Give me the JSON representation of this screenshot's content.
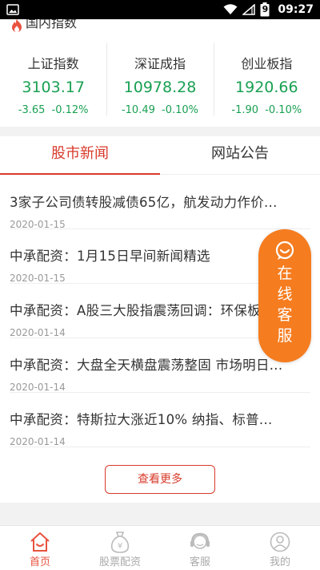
{
  "status_bar": {
    "time": "09:27",
    "battery_level": "9"
  },
  "indices_section": {
    "title": "国内指数",
    "items": [
      {
        "name": "上证指数",
        "value": "3103.17",
        "change": "-3.65",
        "percent": "-0.12%"
      },
      {
        "name": "深证成指",
        "value": "10978.28",
        "change": "-10.49",
        "percent": "-0.10%"
      },
      {
        "name": "创业板指",
        "value": "1920.66",
        "change": "-1.90",
        "percent": "-0.10%"
      }
    ],
    "down_color": "#19a052"
  },
  "news": {
    "tabs": [
      {
        "label": "股市新闻",
        "active": true
      },
      {
        "label": "网站公告",
        "active": false
      }
    ],
    "items": [
      {
        "title": "3家子公司债转股减债65亿，航发动力作价...",
        "date": "2020-01-15"
      },
      {
        "title": "中承配资：1月15日早间新闻精选",
        "date": "2020-01-15"
      },
      {
        "title": "中承配资：A股三大股指震荡回调：环保板块表现活跃",
        "date": "2020-01-14"
      },
      {
        "title": "中承配资：大盘全天横盘震荡整固 市场明日...",
        "date": "2020-01-14"
      },
      {
        "title": "中承配资：特斯拉大涨近10% 纳指、标普...",
        "date": "2020-01-14"
      }
    ],
    "more_label": "查看更多"
  },
  "float_service": {
    "chars": [
      "在",
      "线",
      "客",
      "服"
    ],
    "color": "#f57c1f"
  },
  "bottom_nav": [
    {
      "label": "首页",
      "icon": "home-icon",
      "active": true
    },
    {
      "label": "股票配资",
      "icon": "money-bag-icon",
      "active": false
    },
    {
      "label": "客服",
      "icon": "customer-service-icon",
      "active": false
    },
    {
      "label": "我的",
      "icon": "user-icon",
      "active": false
    }
  ],
  "accent_color": "#d83b2b"
}
